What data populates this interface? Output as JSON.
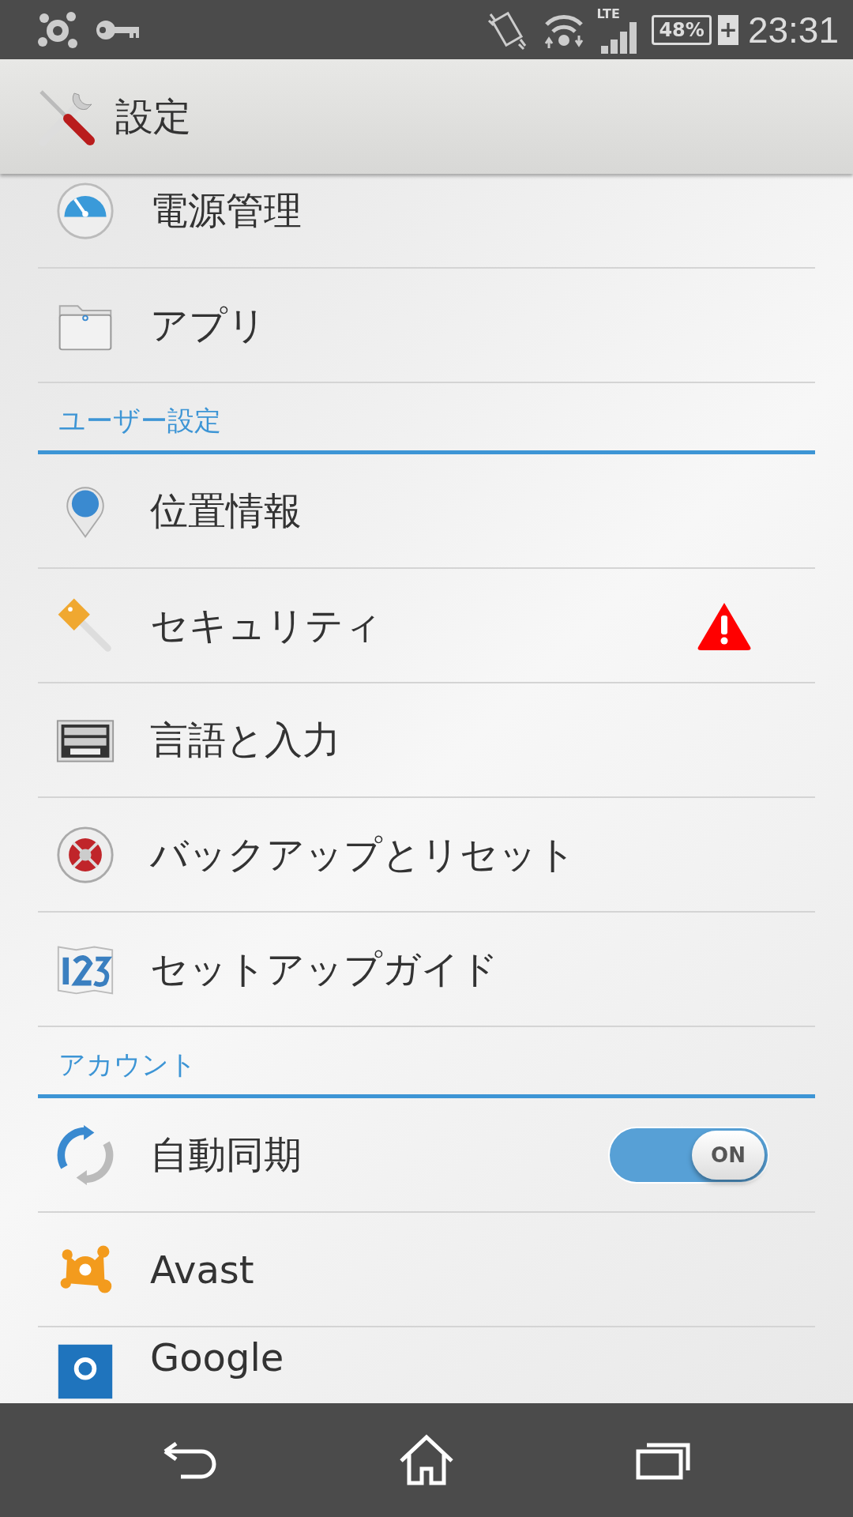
{
  "status_bar": {
    "network": "LTE",
    "battery": "48%",
    "charging": "+",
    "time": "23:31"
  },
  "action_bar": {
    "title": "設定"
  },
  "list": [
    {
      "kind": "item",
      "label": "電源管理",
      "warning": false
    },
    {
      "kind": "item",
      "label": "アプリ",
      "warning": false
    },
    {
      "kind": "header",
      "label": "ユーザー設定"
    },
    {
      "kind": "item",
      "label": "位置情報",
      "warning": false
    },
    {
      "kind": "item",
      "label": "セキュリティ",
      "warning": true
    },
    {
      "kind": "item",
      "label": "言語と入力",
      "warning": false
    },
    {
      "kind": "item",
      "label": "バックアップとリセット",
      "warning": false
    },
    {
      "kind": "item",
      "label": "セットアップガイド",
      "warning": false
    },
    {
      "kind": "header",
      "label": "アカウント"
    },
    {
      "kind": "switch",
      "label": "自動同期",
      "on": true,
      "state_label": "ON"
    },
    {
      "kind": "item",
      "label": "Avast",
      "warning": false
    },
    {
      "kind": "item",
      "label": "Google",
      "warning": false
    }
  ]
}
